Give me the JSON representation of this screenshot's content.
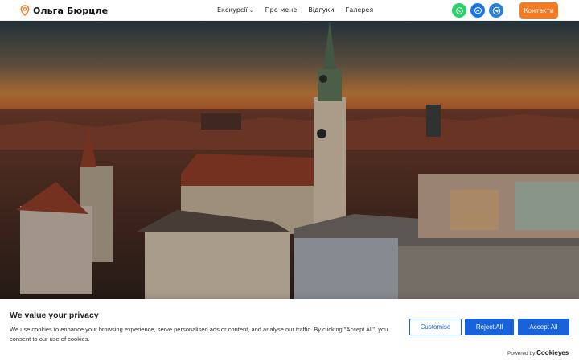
{
  "header": {
    "logo_text": "Ольга Бюрцле",
    "nav": [
      {
        "label": "Екскурсії",
        "has_dropdown": true
      },
      {
        "label": "Про мене"
      },
      {
        "label": "Відгуки"
      },
      {
        "label": "Галерея"
      }
    ],
    "social": [
      "whatsapp-icon",
      "messenger-icon",
      "telegram-icon"
    ],
    "contact_label": "Контакти",
    "accent_color": "#f57b22"
  },
  "cookie_banner": {
    "title": "We value your privacy",
    "text": "We use cookies to enhance your browsing experience, serve personalised ads or content, and analyse our traffic. By clicking \"Accept All\", you consent to our use of cookies.",
    "customise_label": "Customise",
    "reject_label": "Reject All",
    "accept_label": "Accept All",
    "powered_by": "Powered by",
    "brand": "Cookieyes",
    "button_color": "#1863dc"
  }
}
